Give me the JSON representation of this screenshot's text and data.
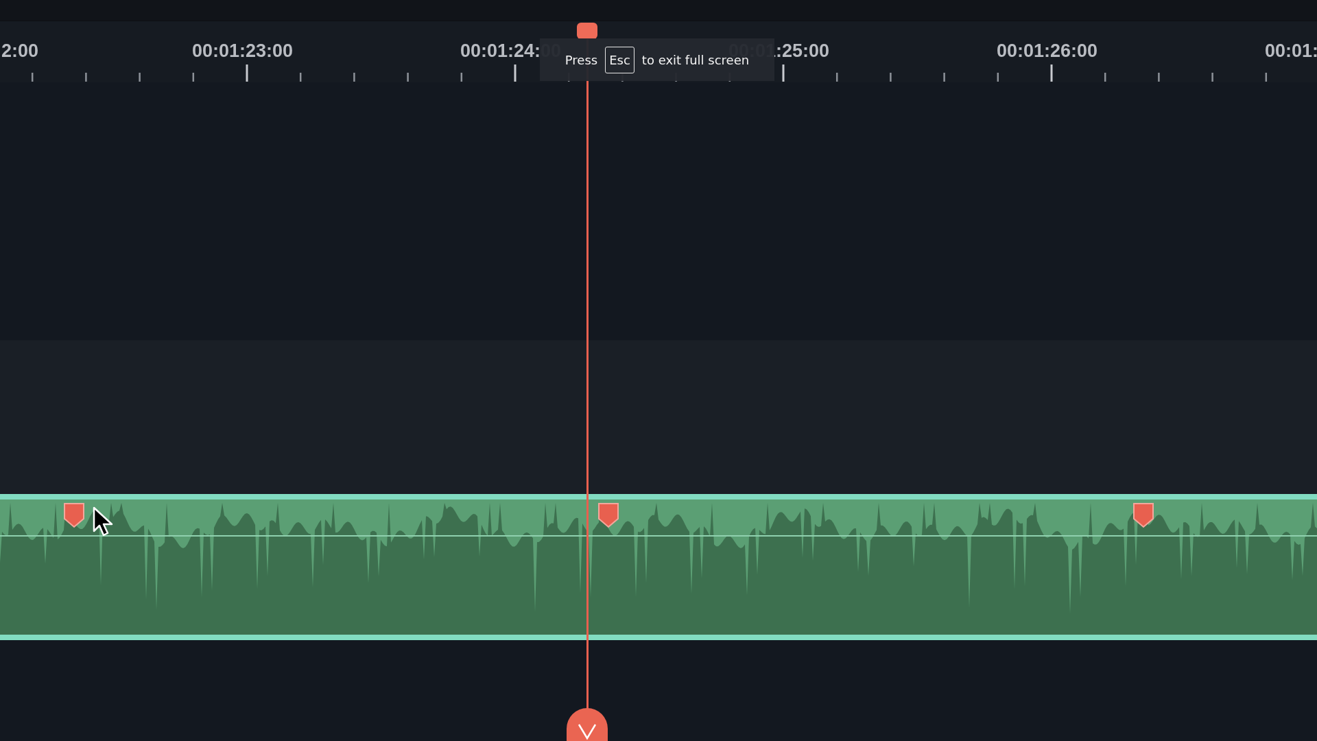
{
  "ruler": {
    "labels": [
      "2:00",
      "00:01:23:00",
      "00:01:24:00",
      "00:01:25:00",
      "00:01:26:00",
      "00:01:"
    ]
  },
  "notice": {
    "before": "Press",
    "key": "Esc",
    "after": "to exit full screen"
  },
  "audio_clip": {
    "kind": "audio",
    "markers": [
      {
        "kind": "marker"
      },
      {
        "kind": "marker"
      },
      {
        "kind": "marker"
      }
    ]
  }
}
